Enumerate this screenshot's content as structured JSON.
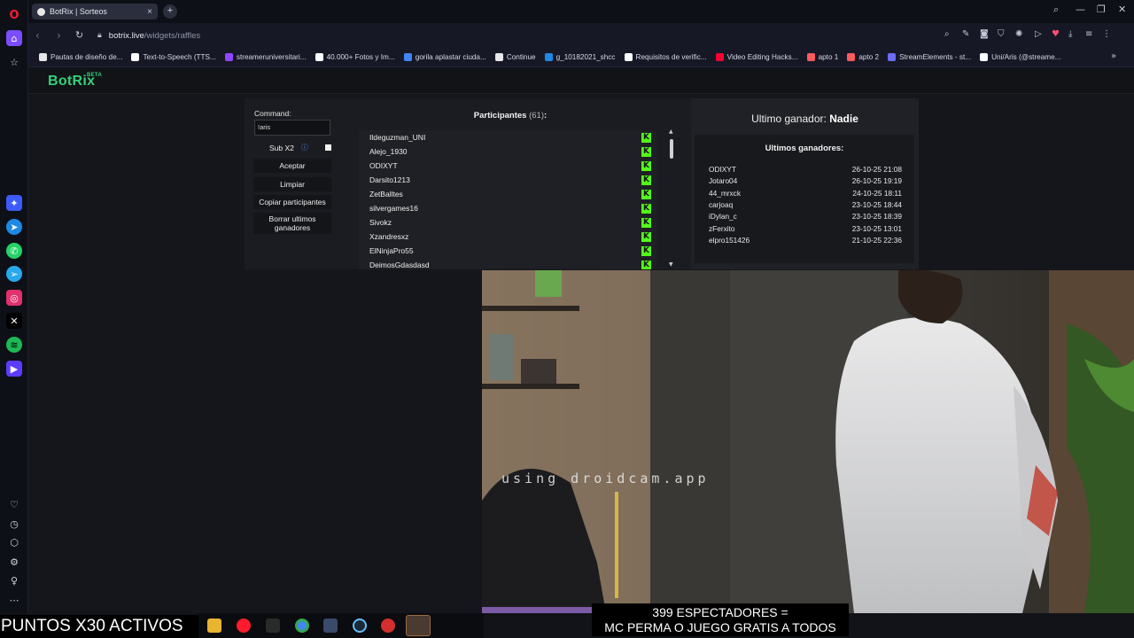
{
  "browser": {
    "tab_title": "BotRix | Sorteos",
    "url_host": "botrix.live",
    "url_path": "/widgets/raffles",
    "bookmarks": [
      {
        "label": "Pautas de diseño de...",
        "color": "#e7e7e7"
      },
      {
        "label": "Text-to-Speech (TTS...",
        "color": "#ffffff"
      },
      {
        "label": "streameruniversitari...",
        "color": "#9146ff"
      },
      {
        "label": "40.000+ Fotos y Im...",
        "color": "#ffffff"
      },
      {
        "label": "gorila aplastar ciuda...",
        "color": "#4285f4"
      },
      {
        "label": "Continue",
        "color": "#e7e7e7"
      },
      {
        "label": "g_10182021_shcc",
        "color": "#1e88e5"
      },
      {
        "label": "Requisitos de verific...",
        "color": "#ffffff"
      },
      {
        "label": "Video Editing Hacks...",
        "color": "#ff0033"
      },
      {
        "label": "apto 1",
        "color": "#ff5a5f"
      },
      {
        "label": "apto 2",
        "color": "#ff5a5f"
      },
      {
        "label": "StreamElements - st...",
        "color": "#6d6dff"
      },
      {
        "label": "Uni/Aris (@streame...",
        "color": "#ffffff"
      }
    ]
  },
  "app": {
    "logo": "BotRix",
    "logo_badge": "BETA",
    "accent": "#33d17a"
  },
  "controls": {
    "command_label": "Command:",
    "command_value": "!aris",
    "sub_label": "Sub X2",
    "accept": "Aceptar",
    "clear": "Limpiar",
    "copy": "Copiar participantes",
    "delete_winners": "Borrar ultimos ganadores"
  },
  "participants": {
    "title": "Participantes",
    "count": "(61)",
    "suffix": ":",
    "items": [
      "Ildeguzman_UNI",
      "Alejo_1930",
      "ODIXYT",
      "Darsito1213",
      "ZetBalltes",
      "silvergames16",
      "Sivokz",
      "Xzandresxz",
      "ElNinjaPro55",
      "DeimosGdasdasd"
    ],
    "platform_icon": "kick-icon"
  },
  "winner": {
    "label": "Ultimo ganador:",
    "name": "Nadie",
    "last_title": "Ultimos ganadores:",
    "rows": [
      {
        "name": "ODIXYT",
        "date": "26-10-25 21:08"
      },
      {
        "name": "Jotaro04",
        "date": "26-10-25 19:19"
      },
      {
        "name": "44_mrxck",
        "date": "24-10-25 18:11"
      },
      {
        "name": "carjoaq",
        "date": "23-10-25 18:44"
      },
      {
        "name": "iDylan_c",
        "date": "23-10-25 18:39"
      },
      {
        "name": "zFerxito",
        "date": "23-10-25 13:01"
      },
      {
        "name": "elpro151426",
        "date": "21-10-25 22:36"
      }
    ]
  },
  "stream": {
    "cam_watermark": "using droidcam.app",
    "points_text": "PUNTOS X30 ACTIVOS",
    "viewers_line1": "399 ESPECTADORES =",
    "viewers_line2": "MC PERMA O JUEGO GRATIS A TODOS"
  }
}
